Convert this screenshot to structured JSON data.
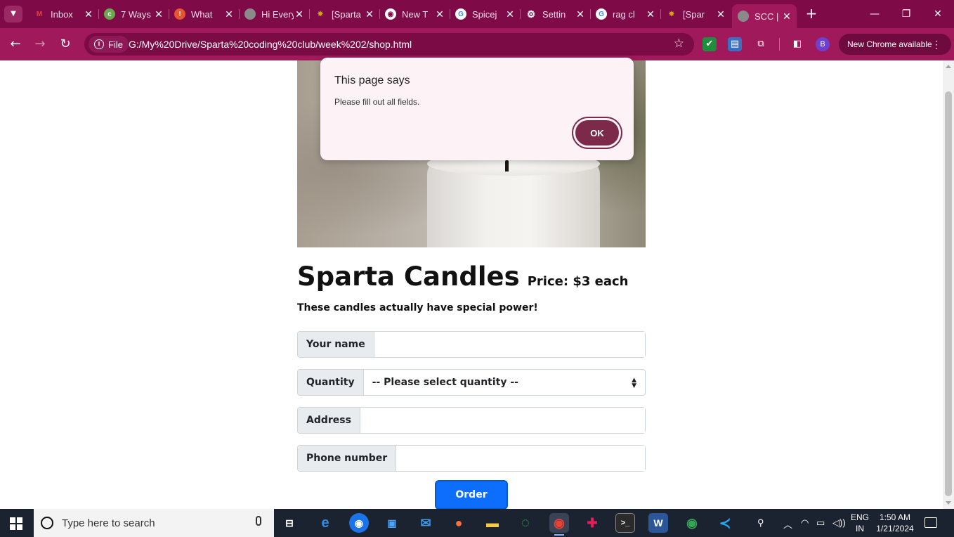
{
  "browser": {
    "tabs": [
      {
        "title": "Inbox",
        "favicon": "gmail-icon",
        "color": "#ea4335"
      },
      {
        "title": "7 Ways",
        "favicon": "site-icon",
        "color": "#6aa84f"
      },
      {
        "title": "What",
        "favicon": "alert-icon",
        "color": "#e8542f"
      },
      {
        "title": "Hi Every",
        "favicon": "globe-icon",
        "color": "#8a8a8a"
      },
      {
        "title": "[Sparta",
        "favicon": "sparta-icon",
        "color": "#d0a21c"
      },
      {
        "title": "New T",
        "favicon": "chrome-icon",
        "color": "#ffffff"
      },
      {
        "title": "Spicej",
        "favicon": "google-icon",
        "color": "#ffffff"
      },
      {
        "title": "Settin",
        "favicon": "gear-icon",
        "color": "#ffffff"
      },
      {
        "title": "rag cl",
        "favicon": "google-icon",
        "color": "#ffffff"
      },
      {
        "title": "[Spar",
        "favicon": "sparta-icon",
        "color": "#d0a21c"
      },
      {
        "title": "SCC |",
        "favicon": "globe-icon",
        "color": "#8a8a8a"
      }
    ],
    "url_chip": "File",
    "url": "G:/My%20Drive/Sparta%20coding%20club/week%202/shop.html",
    "profile_initial": "B",
    "update_label": "New Chrome available",
    "accent": "#a01a5b",
    "tabstrip_color": "#7e0a47"
  },
  "alert": {
    "title": "This page says",
    "message": "Please fill out all fields.",
    "ok_label": "OK"
  },
  "page": {
    "title": "Sparta Candles",
    "price": "Price: $3 each",
    "tagline": "These candles actually have special power!",
    "fields": {
      "name_label": "Your name",
      "name_value": "",
      "quantity_label": "Quantity",
      "quantity_selected": "-- Please select quantity --",
      "address_label": "Address",
      "address_value": "",
      "phone_label": "Phone number",
      "phone_value": ""
    },
    "order_label": "Order",
    "order_color": "#0d6efd"
  },
  "taskbar": {
    "search_placeholder": "Type here to search",
    "lang_line1": "ENG",
    "lang_line2": "IN",
    "time": "1:50 AM",
    "date": "1/21/2024"
  }
}
